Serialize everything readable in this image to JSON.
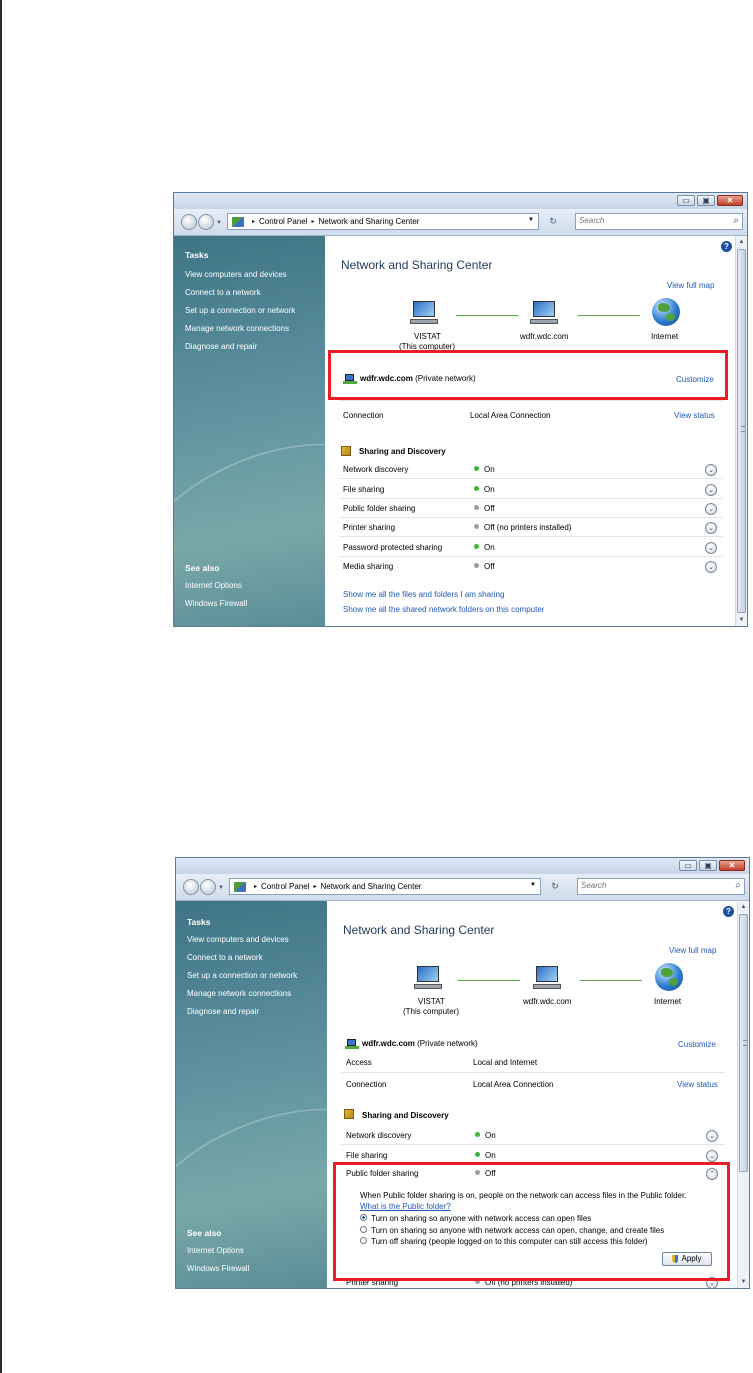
{
  "window": {
    "breadcrumb": [
      "Control Panel",
      "Network and Sharing Center"
    ],
    "search_placeholder": "Search",
    "minimize_glyph": "▭",
    "maximize_glyph": "▣",
    "close_glyph": "✕"
  },
  "sidebar": {
    "tasks_heading": "Tasks",
    "tasks": [
      "View computers and devices",
      "Connect to a network",
      "Set up a connection or network",
      "Manage network connections",
      "Diagnose and repair"
    ],
    "see_also_heading": "See also",
    "see_also": [
      "Internet Options",
      "Windows Firewall"
    ]
  },
  "main": {
    "title": "Network and Sharing Center",
    "view_full_map": "View full map",
    "map": {
      "computer_name": "VISTAT",
      "computer_sub": "(This computer)",
      "network_name": "wdfr.wdc.com",
      "internet_label": "Internet"
    },
    "network": {
      "name": "wdfr.wdc.com",
      "type": "(Private network)",
      "customize": "Customize",
      "access_label": "Access",
      "access_value": "Local and Internet",
      "connection_label": "Connection",
      "connection_value": "Local Area Connection",
      "view_status": "View status"
    },
    "sharing": {
      "heading": "Sharing and Discovery",
      "rows": [
        {
          "label": "Network discovery",
          "value": "On",
          "state": "on"
        },
        {
          "label": "File sharing",
          "value": "On",
          "state": "on"
        },
        {
          "label": "Public folder sharing",
          "value": "Off",
          "state": "off"
        },
        {
          "label": "Printer sharing",
          "value": "Off (no printers installed)",
          "state": "off"
        },
        {
          "label": "Password protected sharing",
          "value": "On",
          "state": "on"
        },
        {
          "label": "Media sharing",
          "value": "Off",
          "state": "off"
        }
      ],
      "show_files_link": "Show me all the files and folders I am sharing",
      "show_folders_link": "Show me all the shared network folders on this computer"
    },
    "public_folder_expanded": {
      "description": "When Public folder sharing is on, people on the network can access files in the Public folder.",
      "what_is_link": "What is the Public folder?",
      "options": [
        "Turn on sharing so anyone with network access can open files",
        "Turn on sharing so anyone with network access can open, change, and create files",
        "Turn off sharing (people logged on to this computer can still access this folder)"
      ],
      "selected_option": 0,
      "apply_label": "Apply"
    }
  },
  "icons": {
    "help": "?",
    "chevron_down": "⌄",
    "chevron_up": "⌃",
    "search": "⌕",
    "refresh": "↻",
    "forward_arrow": "▸",
    "dropdown": "▼"
  },
  "colors": {
    "highlight_box": "#ec1c24",
    "status_on": "#3bb53b",
    "status_off": "#9aa0a6",
    "link": "#1f5ab8",
    "sidebar": "#5f93a0"
  }
}
